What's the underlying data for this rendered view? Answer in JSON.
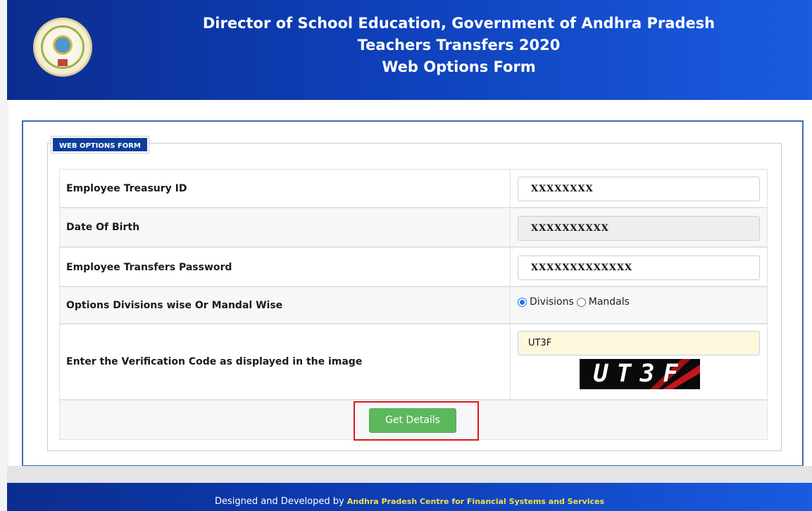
{
  "header": {
    "line1": "Director of School Education, Government of Andhra Pradesh",
    "line2": "Teachers Transfers 2020",
    "line3": "Web Options Form"
  },
  "form": {
    "legend": "WEB OPTIONS FORM",
    "treasury_id": {
      "label": "Employee Treasury ID",
      "value": "XXXXXXXX"
    },
    "dob": {
      "label": "Date Of Birth",
      "value": "XXXXXXXXXX"
    },
    "password": {
      "label": "Employee Transfers Password",
      "value": "XXXXXXXXXXXXX"
    },
    "options": {
      "label": "Options Divisions wise Or Mandal Wise",
      "choices": [
        "Divisions",
        "Mandals"
      ],
      "selected": "Divisions"
    },
    "verification": {
      "label": "Enter the Verification Code as displayed in the image",
      "value": "UT3F",
      "captcha_text": "UT3F"
    },
    "submit_label": "Get Details"
  },
  "footer": {
    "prefix": "Designed and Developed by ",
    "org": "Andhra Pradesh Centre for Financial Systems and Services"
  },
  "colors": {
    "header_blue": "#0e3fb8",
    "legend_blue": "#0d3e9b",
    "button_green": "#5cb85c",
    "highlight_red": "#e0151d",
    "footer_org_yellow": "#f0e14a"
  },
  "icons": [
    "state-emblem-icon",
    "radio-checked-icon",
    "radio-unchecked-icon"
  ]
}
